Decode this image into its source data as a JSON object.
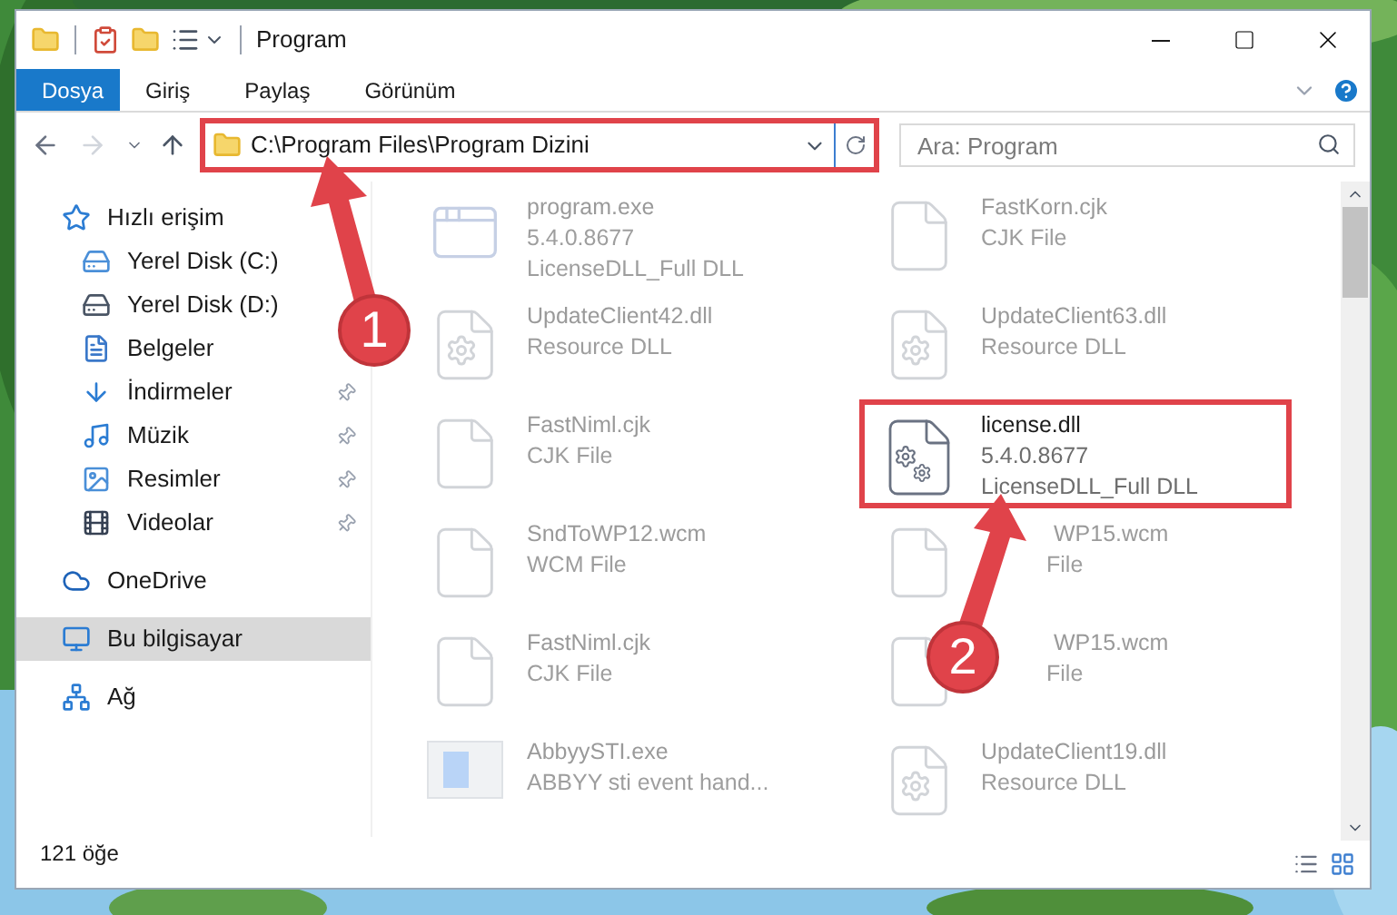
{
  "window": {
    "title": "Program"
  },
  "ribbon_tabs": [
    {
      "label": "Dosya",
      "selected": true
    },
    {
      "label": "Giriş",
      "selected": false
    },
    {
      "label": "Paylaş",
      "selected": false
    },
    {
      "label": "Görünüm",
      "selected": false
    }
  ],
  "address_bar": {
    "path": "C:\\Program Files\\Program Dizini",
    "highlighted": true
  },
  "search": {
    "placeholder": "Ara: Program"
  },
  "sidebar": {
    "items": [
      {
        "label": "Hızlı erişim",
        "kind": "star",
        "selected": false,
        "children": [
          {
            "label": "Yerel Disk (C:)",
            "kind": "drive-c",
            "pinned": false,
            "selected": false
          },
          {
            "label": "Yerel Disk (D:)",
            "kind": "drive",
            "pinned": false,
            "selected": false
          },
          {
            "label": "Belgeler",
            "kind": "documents",
            "pinned": false,
            "selected": false
          },
          {
            "label": "İndirmeler",
            "kind": "downloads",
            "pinned": true,
            "selected": false
          },
          {
            "label": "Müzik",
            "kind": "music",
            "pinned": true,
            "selected": false
          },
          {
            "label": "Resimler",
            "kind": "pictures",
            "pinned": true,
            "selected": false
          },
          {
            "label": "Videolar",
            "kind": "videos",
            "pinned": true,
            "selected": false
          }
        ]
      },
      {
        "label": "OneDrive",
        "kind": "cloud",
        "selected": false
      },
      {
        "label": "Bu bilgisayar",
        "kind": "computer",
        "selected": true
      },
      {
        "label": "Ağ",
        "kind": "network",
        "selected": false
      }
    ]
  },
  "files": [
    {
      "name": "program.exe",
      "details": [
        "5.4.0.8677",
        "LicenseDLL_Full DLL"
      ],
      "kind": "exe",
      "highlighted": false
    },
    {
      "name": "FastKorn.cjk",
      "details": [
        "CJK File"
      ],
      "kind": "blank",
      "highlighted": false
    },
    {
      "name": "UpdateClient42.dll",
      "details": [
        "Resource DLL"
      ],
      "kind": "resource",
      "highlighted": false
    },
    {
      "name": "UpdateClient63.dll",
      "details": [
        "Resource DLL"
      ],
      "kind": "resource",
      "highlighted": false
    },
    {
      "name": "FastNiml.cjk",
      "details": [
        "CJK File"
      ],
      "kind": "blank",
      "highlighted": false
    },
    {
      "name": "license.dll",
      "details": [
        "5.4.0.8677",
        "LicenseDLL_Full DLL"
      ],
      "kind": "gears",
      "highlighted": true
    },
    {
      "name": "SndToWP12.wcm",
      "details": [
        "WCM File"
      ],
      "kind": "blank",
      "highlighted": false
    },
    {
      "name": "WP15.wcm",
      "details": [
        "File"
      ],
      "kind": "blank",
      "highlighted": false,
      "covered": true
    },
    {
      "name": "FastNiml.cjk",
      "details": [
        "CJK File"
      ],
      "kind": "blank",
      "highlighted": false
    },
    {
      "name": "WP15.wcm",
      "details": [
        "File"
      ],
      "kind": "blank",
      "highlighted": false,
      "covered": true
    },
    {
      "name": "AbbyySTI.exe",
      "details": [
        "ABBYY sti event hand..."
      ],
      "kind": "app",
      "highlighted": false
    },
    {
      "name": "UpdateClient19.dll",
      "details": [
        "Resource DLL"
      ],
      "kind": "resource",
      "highlighted": false
    }
  ],
  "status_bar": {
    "text": "121 öğe"
  },
  "annotations": [
    {
      "number": "1"
    },
    {
      "number": "2"
    }
  ]
}
